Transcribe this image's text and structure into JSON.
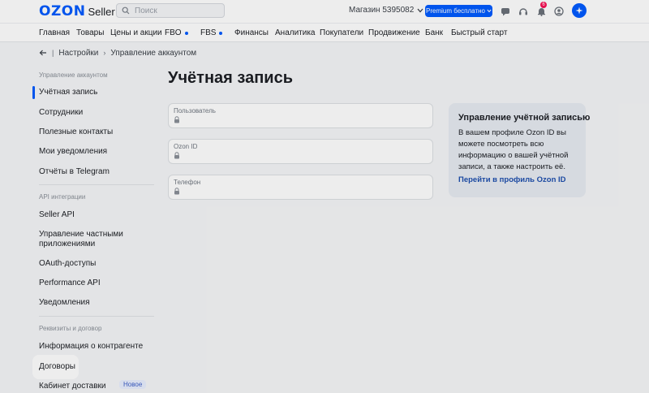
{
  "header": {
    "logo_brand": "OZON",
    "logo_product": "Seller",
    "search_placeholder": "Поиск",
    "store_label": "Магазин 5395082",
    "premium_label": "Premium бесплатно",
    "notification_count": "6",
    "icons": [
      "chat-icon",
      "headset-icon",
      "bell-icon",
      "user-icon",
      "assistant-icon"
    ]
  },
  "nav": {
    "items": [
      "Главная",
      "Товары",
      "Цены и акции",
      "FBO",
      "FBS",
      "Финансы",
      "Аналитика",
      "Покупатели",
      "Продвижение",
      "Банк",
      "Быстрый старт"
    ]
  },
  "breadcrumb": {
    "items": [
      "Настройки",
      "Управление аккаунтом"
    ]
  },
  "sidebar": {
    "section_account": "Управление аккаунтом",
    "account_items": [
      "Учётная запись",
      "Сотрудники",
      "Полезные контакты",
      "Мои уведомления",
      "Отчёты в Telegram"
    ],
    "section_api": "API интеграции",
    "api_items": [
      "Seller API",
      "Управление частными приложениями",
      "OAuth-доступы",
      "Performance API",
      "Уведомления"
    ],
    "section_requisites": "Реквизиты и договор",
    "requisites_items": [
      "Информация о контрагенте",
      "Договоры",
      "Кабинет доставки"
    ],
    "new_badge": "Новое"
  },
  "main": {
    "title": "Учётная запись",
    "fields": [
      {
        "label": "Пользователь",
        "value": ""
      },
      {
        "label": "Ozon ID",
        "value": ""
      },
      {
        "label": "Телефон",
        "value": ""
      }
    ]
  },
  "info_card": {
    "title": "Управление учётной записью",
    "text": "В вашем профиле Ozon ID вы можете посмотреть всю информацию о вашей учётной записи, а также настроить её.",
    "link": "Перейти в профиль Ozon ID"
  },
  "colors": {
    "accent": "#005bff",
    "background": "#f5f6f8",
    "link": "#1e4fae"
  }
}
